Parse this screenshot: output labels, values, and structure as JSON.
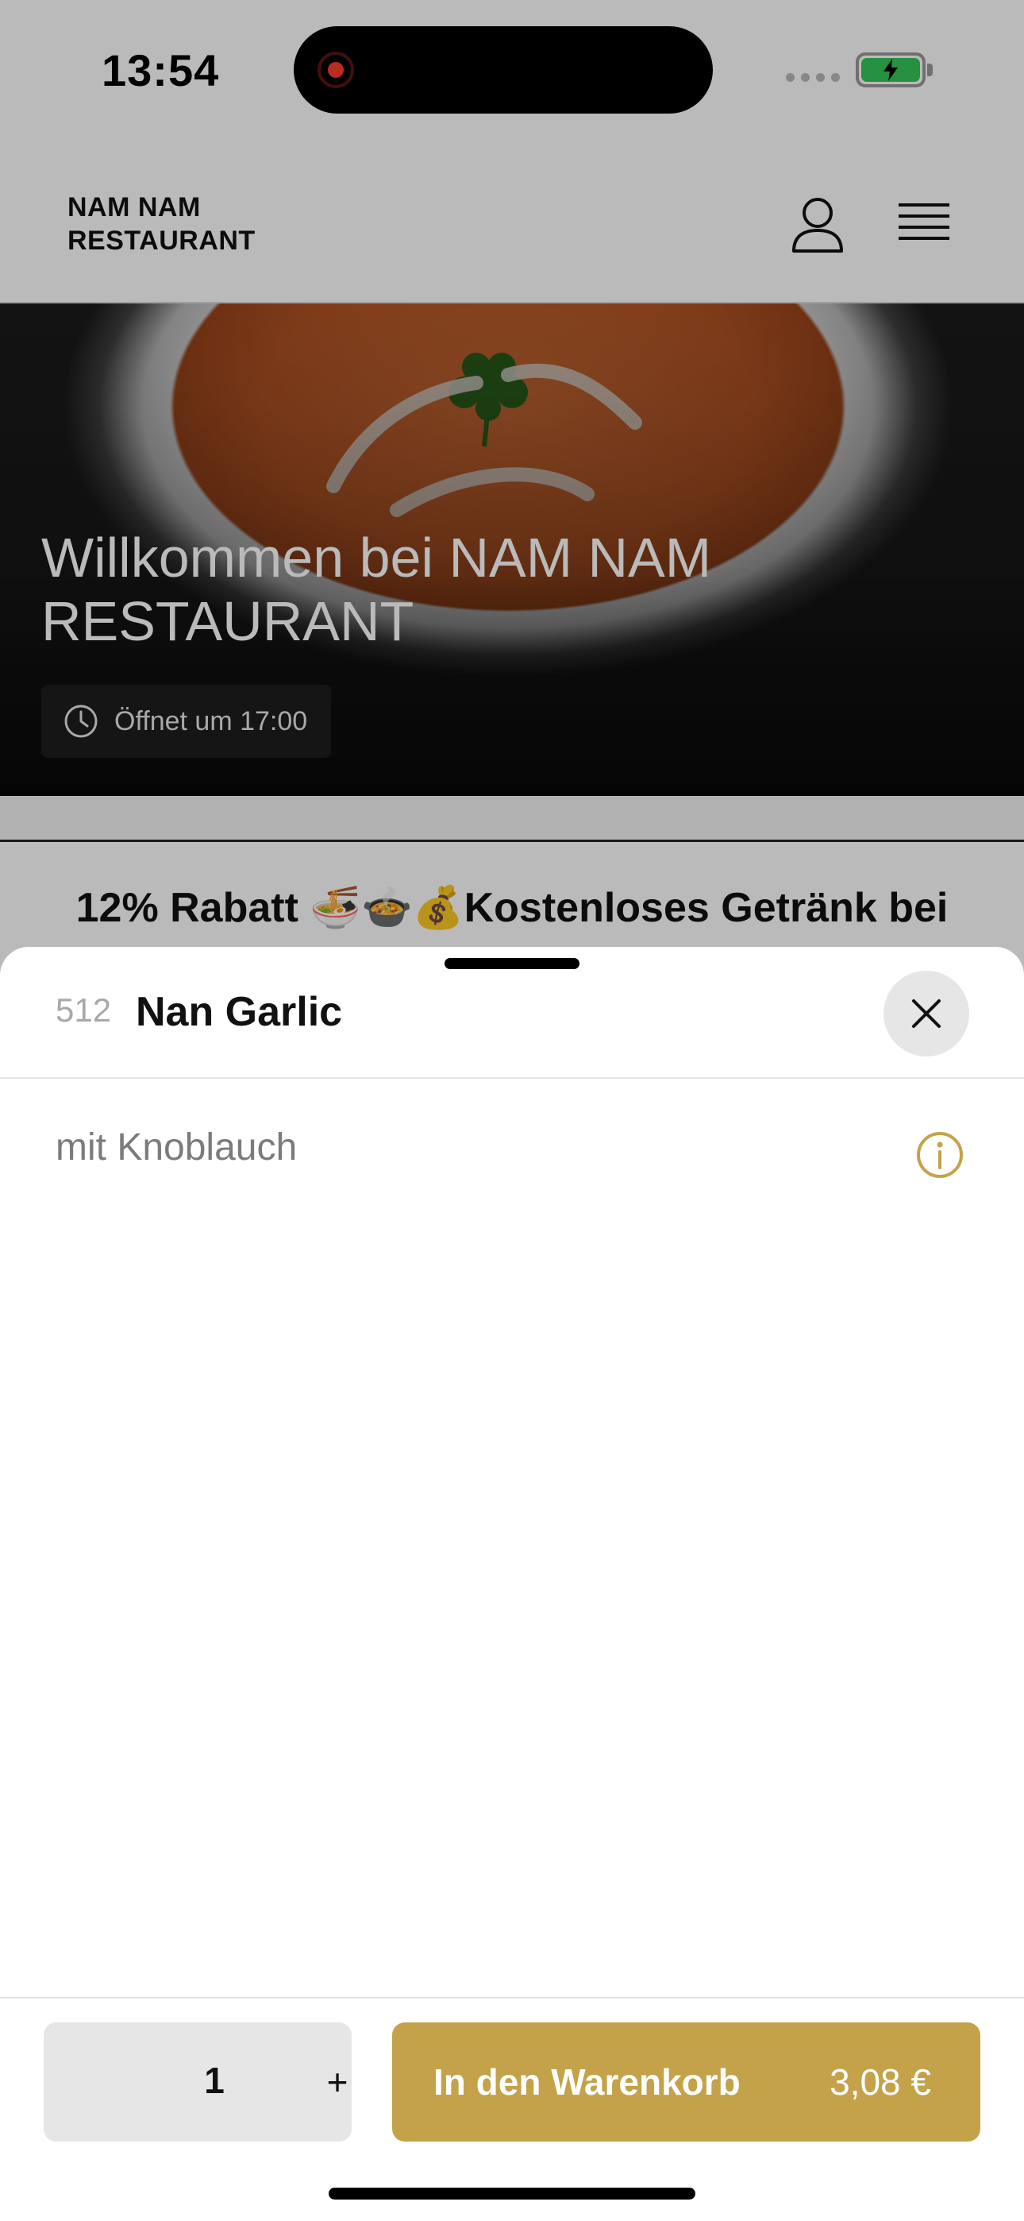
{
  "status_bar": {
    "time": "13:54"
  },
  "header": {
    "logo_line1": "NAM NAM",
    "logo_line2": "RESTAURANT",
    "user_icon": "user-icon",
    "menu_icon": "hamburger-menu-icon"
  },
  "hero": {
    "title": "Willkommen bei NAM NAM RESTAURANT",
    "hours_label": "Öffnet um 17:00",
    "hours_icon": "clock-icon"
  },
  "promo": {
    "text": "12% Rabatt 🍜🍲💰Kostenloses Getränk bei"
  },
  "product_sheet": {
    "item_number": "512",
    "item_name": "Nan Garlic",
    "description": "mit Knoblauch",
    "close_icon": "close-icon",
    "info_icon": "info-icon",
    "quantity": "1",
    "plus_label": "+",
    "add_to_cart_label": "In den Warenkorb",
    "price": "3,08 €",
    "accent_color": "#c3a24a"
  }
}
